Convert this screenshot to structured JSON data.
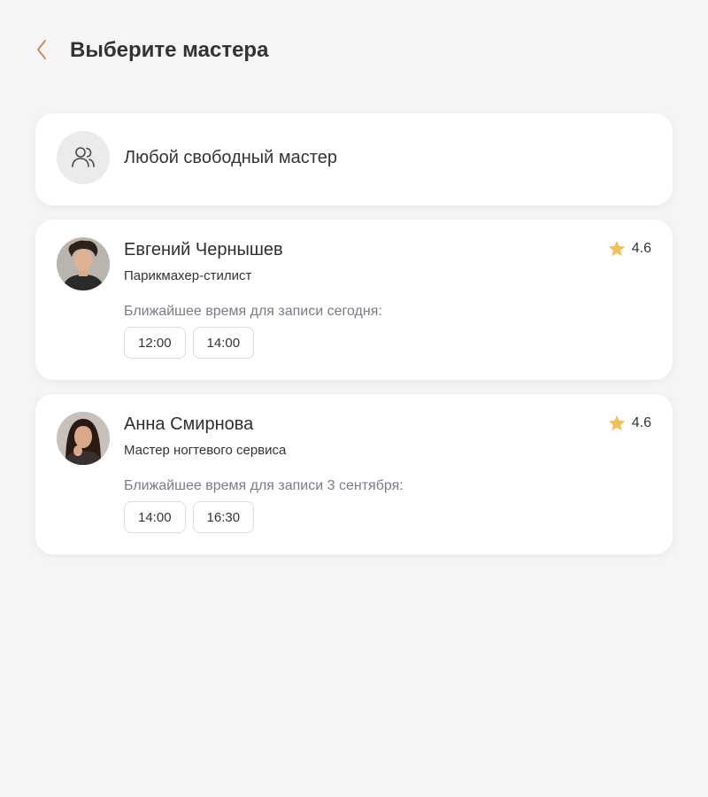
{
  "header": {
    "title": "Выберите мастера",
    "back_icon": "chevron-left-icon",
    "accent_color": "#c98a6a"
  },
  "any_master": {
    "label": "Любой свободный мастер",
    "icon": "users-icon"
  },
  "masters": [
    {
      "name": "Евгений Чернышев",
      "role": "Парикмахер-стилист",
      "rating": "4.6",
      "slots_caption": "Ближайшее время для записи сегодня:",
      "slots": [
        "12:00",
        "14:00"
      ]
    },
    {
      "name": "Анна Смирнова",
      "role": "Мастер ногтевого сервиса",
      "rating": "4.6",
      "slots_caption": "Ближайшее время для записи 3 сентября:",
      "slots": [
        "14:00",
        "16:30"
      ]
    }
  ],
  "colors": {
    "star": "#f0c05a",
    "background": "#f5f5f5",
    "card": "#ffffff"
  }
}
